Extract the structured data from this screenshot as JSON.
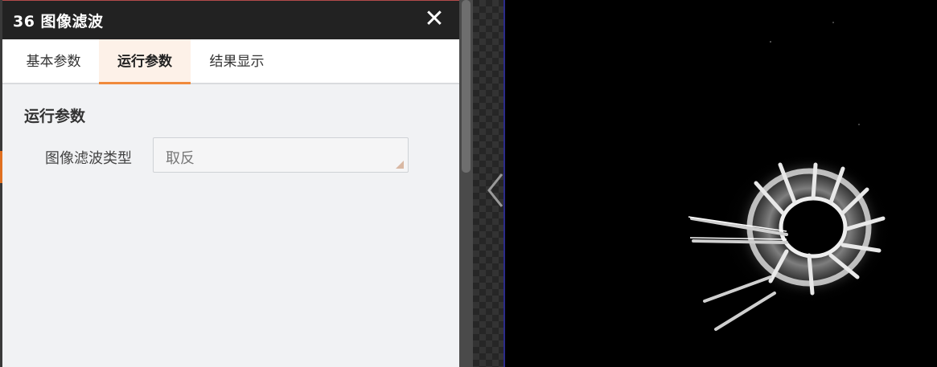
{
  "dialog": {
    "title": "36 图像滤波",
    "close_glyph": "✕"
  },
  "tabs": [
    {
      "label": "基本参数",
      "active": false
    },
    {
      "label": "运行参数",
      "active": true
    },
    {
      "label": "结果显示",
      "active": false
    }
  ],
  "run_params": {
    "section_title": "运行参数",
    "filter_type": {
      "label": "图像滤波类型",
      "value": "取反"
    }
  },
  "icons": {
    "close": "close-icon",
    "dropdown": "dropdown-corner-icon",
    "collapse": "chevron-left-icon"
  },
  "colors": {
    "accent": "#f08a3c",
    "title_bar": "#222222",
    "left_edge_accent": "#e07020",
    "image_background": "#000000"
  }
}
